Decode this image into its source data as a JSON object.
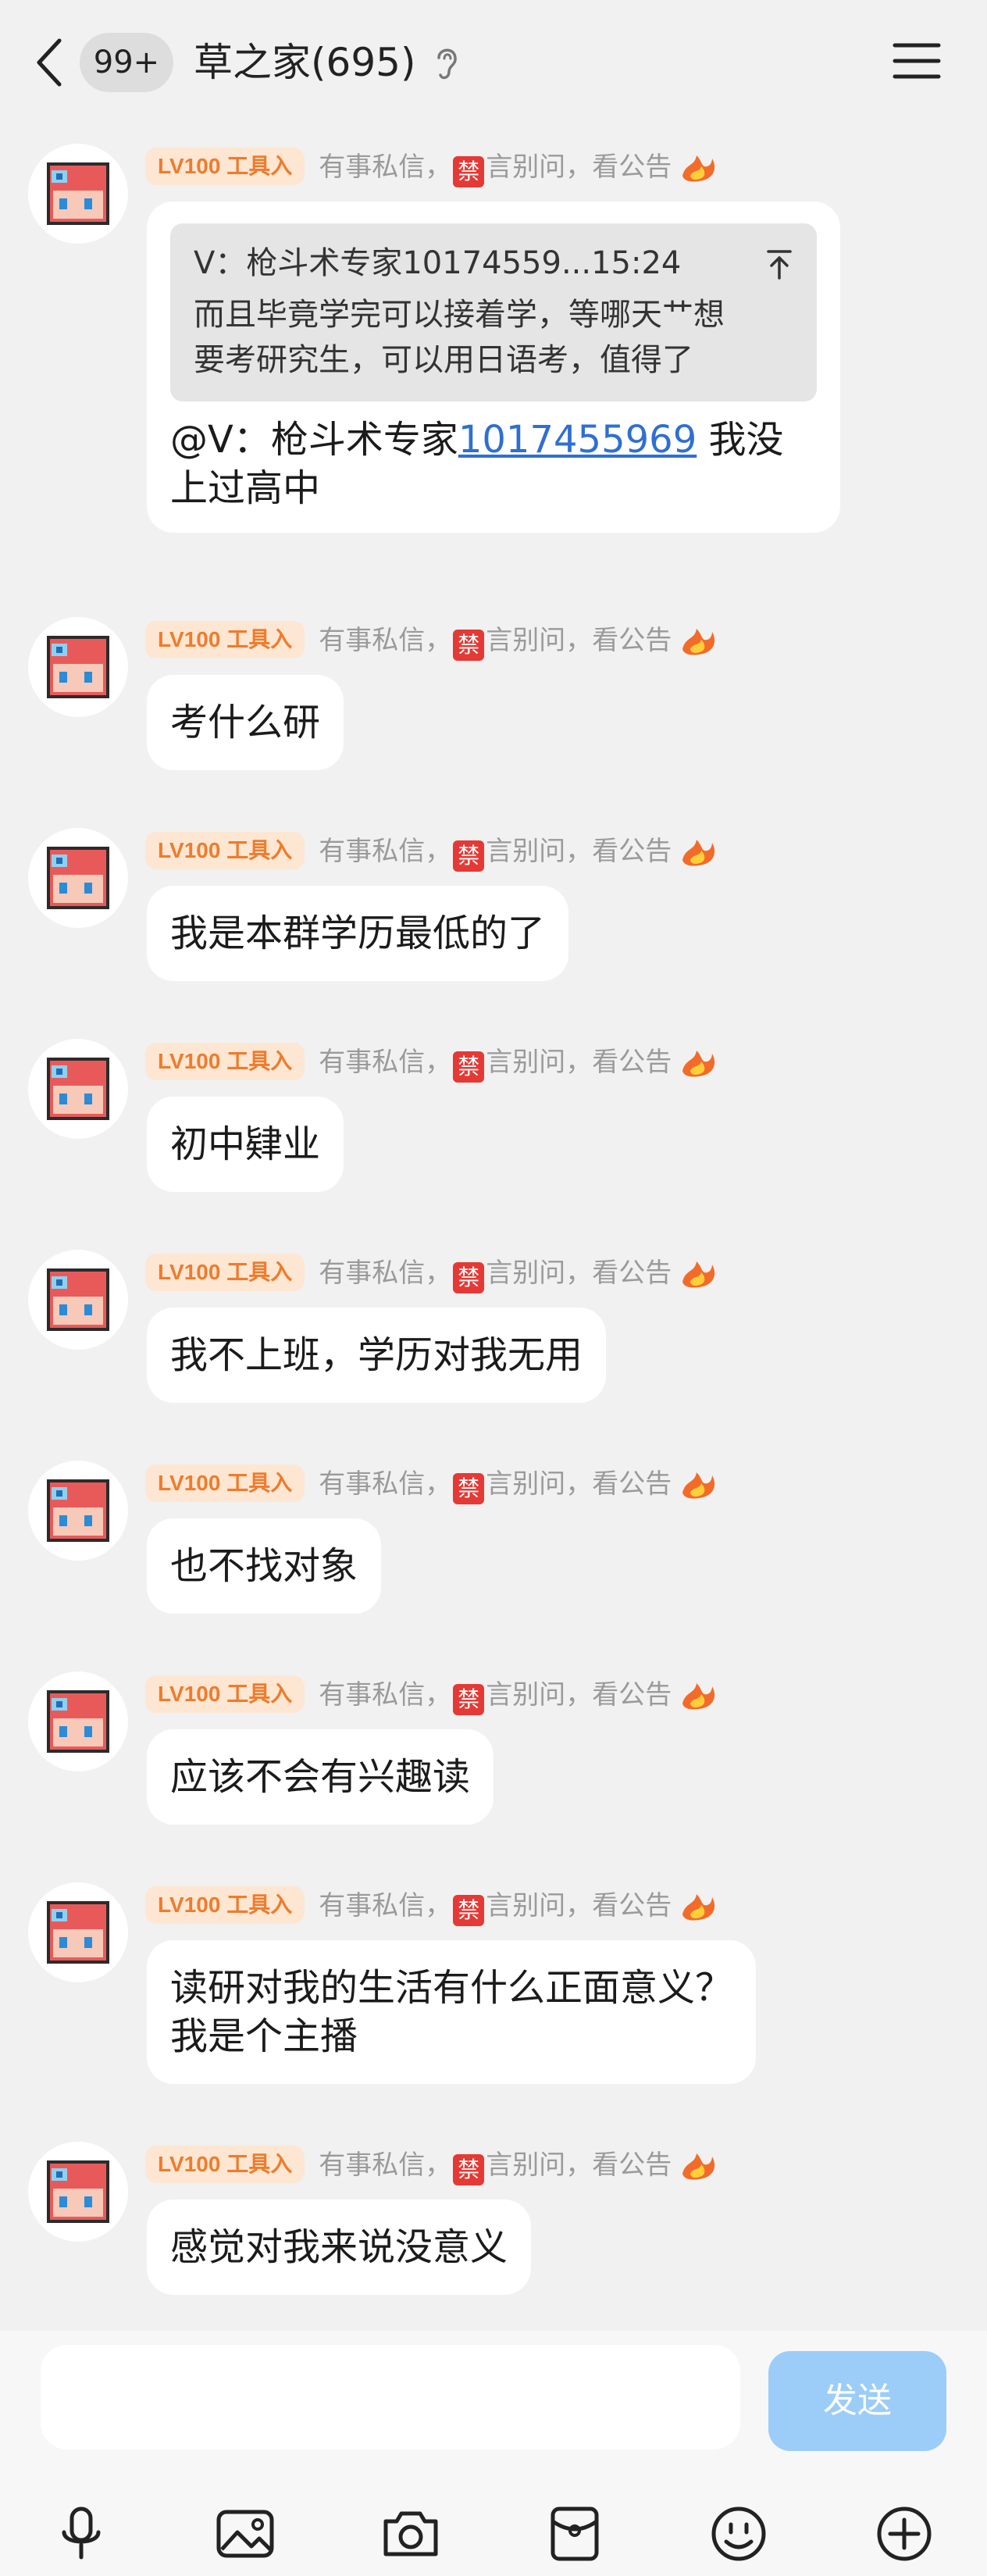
{
  "header": {
    "unread_count": "99+",
    "title": "草之家(695)",
    "back_icon": "chevron-left-icon",
    "ear_icon": "ear-icon",
    "menu_icon": "hamburger-menu-icon"
  },
  "sender_meta": {
    "level_badge": "LV100 工具入",
    "notice_before": "有事私信，",
    "ban_char": "禁",
    "notice_after": "言别问，看公告"
  },
  "messages": [
    {
      "quote_header": "V：枪斗术专家10174559...15:24",
      "quote_body_line1": "而且毕竟学完可以接着学，等哪天艹想",
      "quote_body_line2": "要考研究生，可以用日语考，值得了",
      "mention_prefix": "@V：枪斗术专家",
      "mention_number": "1017455969",
      "text_line1_suffix": " 我没",
      "text_line2": "上过高中"
    },
    {
      "text": "考什么研"
    },
    {
      "text": "我是本群学历最低的了"
    },
    {
      "text": "初中肄业"
    },
    {
      "text": "我不上班，学历对我无用"
    },
    {
      "text": "也不找对象"
    },
    {
      "text": "应该不会有兴趣读"
    },
    {
      "text_line1": "读研对我的生活有什么正面意义？",
      "text_line2": "我是个主播"
    },
    {
      "text": "感觉对我来说没意义"
    }
  ],
  "input_bar": {
    "input_value": "",
    "send_label": "发送",
    "tools": [
      "microphone-icon",
      "image-icon",
      "camera-icon",
      "red-packet-icon",
      "emoji-icon",
      "plus-icon"
    ]
  },
  "colors": {
    "background": "#f0f1f0",
    "bubble": "#ffffff",
    "level_badge_bg": "#fde7d3",
    "level_badge_text": "#f07b2c",
    "ban_mark": "#e53935",
    "link": "#2f6fd2",
    "send_button": "#9ccdf8"
  }
}
